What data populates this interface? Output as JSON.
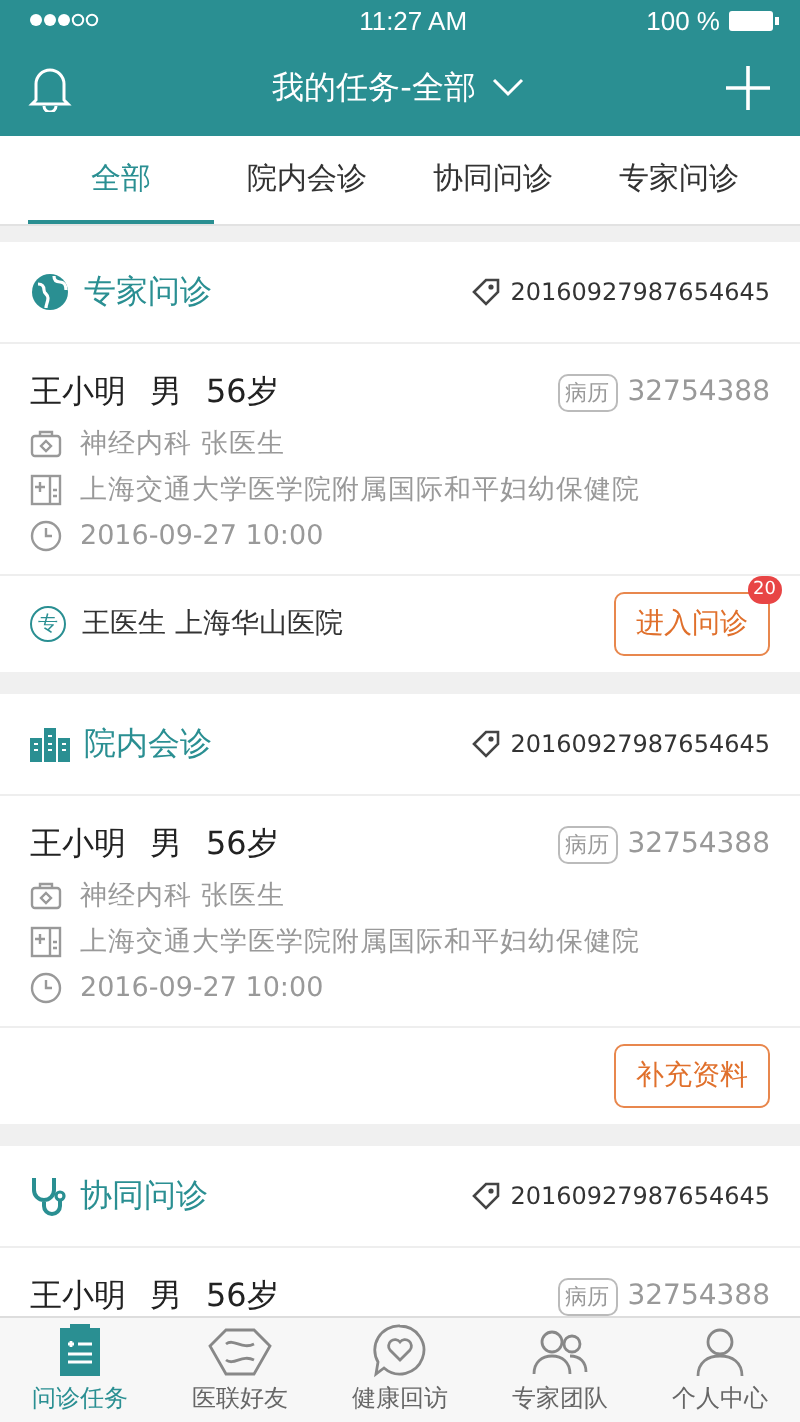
{
  "status_bar": {
    "time": "11:27 AM",
    "battery": "100 %"
  },
  "nav": {
    "title": "我的任务-全部"
  },
  "tabs": [
    {
      "label": "全部",
      "selected": true
    },
    {
      "label": "院内会诊",
      "selected": false
    },
    {
      "label": "协同问诊",
      "selected": false
    },
    {
      "label": "专家问诊",
      "selected": false
    }
  ],
  "cards": [
    {
      "kind": "expert",
      "type_label": "专家问诊",
      "order_no": "20160927987654645",
      "name": "王小明",
      "gender": "男",
      "age": "56岁",
      "record_label": "病历",
      "record_no": "32754388",
      "department": "神经内科 张医生",
      "hospital": "上海交通大学医学院附属国际和平妇幼保健院",
      "time": "2016-09-27 10:00",
      "footer": {
        "doctor_mark": "专",
        "doctor": "王医生 上海华山医院",
        "button": "进入问诊",
        "badge": "20"
      }
    },
    {
      "kind": "hospital",
      "type_label": "院内会诊",
      "order_no": "20160927987654645",
      "name": "王小明",
      "gender": "男",
      "age": "56岁",
      "record_label": "病历",
      "record_no": "32754388",
      "department": "神经内科 张医生",
      "hospital": "上海交通大学医学院附属国际和平妇幼保健院",
      "time": "2016-09-27 10:00",
      "footer": {
        "button": "补充资料"
      }
    },
    {
      "kind": "collab",
      "type_label": "协同问诊",
      "order_no": "20160927987654645",
      "name": "王小明",
      "gender": "男",
      "age": "56岁",
      "record_label": "病历",
      "record_no": "32754388"
    }
  ],
  "bottom_tabs": [
    {
      "kind": "clipboard",
      "label": "问诊任务",
      "selected": true
    },
    {
      "kind": "friends",
      "label": "医联好友",
      "selected": false
    },
    {
      "kind": "heart",
      "label": "健康回访",
      "selected": false
    },
    {
      "kind": "team",
      "label": "专家团队",
      "selected": false
    },
    {
      "kind": "person",
      "label": "个人中心",
      "selected": false
    }
  ]
}
